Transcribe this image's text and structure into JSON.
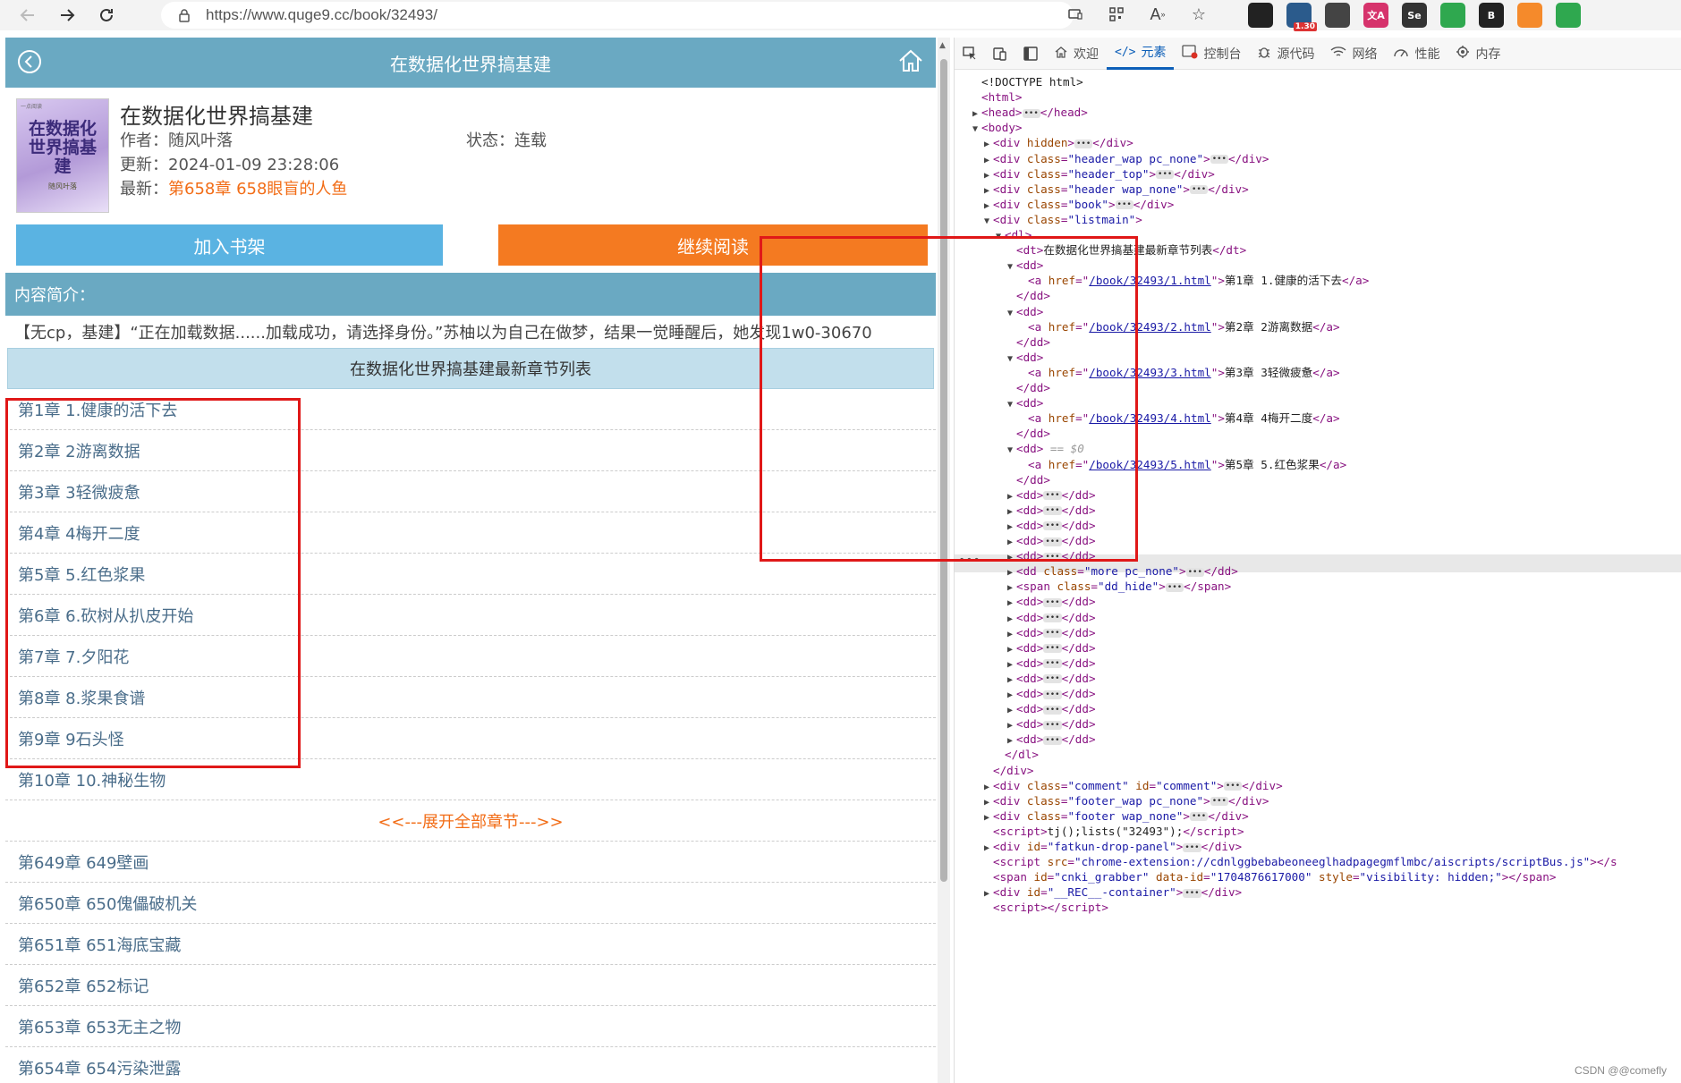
{
  "browser": {
    "url": "https://www.quge9.cc/book/32493/",
    "extensions": [
      {
        "name": "devtools-ext-icon",
        "color": "#222",
        "label": ""
      },
      {
        "name": "timer-ext-icon",
        "color": "#2b5b8c",
        "label": "",
        "badge": "1.30"
      },
      {
        "name": "gauge-ext-icon",
        "color": "#444",
        "label": ""
      },
      {
        "name": "translate-ext-icon",
        "color": "#d6336c",
        "label": "文A"
      },
      {
        "name": "selenium-ext-icon",
        "color": "#333",
        "label": "Se"
      },
      {
        "name": "shield-ext-icon",
        "color": "#2fa84f",
        "label": ""
      },
      {
        "name": "coin-ext-icon",
        "color": "#222",
        "label": "B"
      },
      {
        "name": "fire-ext-icon",
        "color": "#f58a2b",
        "label": ""
      },
      {
        "name": "download-ext-icon",
        "color": "#2fa84f",
        "label": ""
      }
    ]
  },
  "page": {
    "header_title": "在数据化世界搞基建",
    "book_title": "在数据化世界搞基建",
    "cover": {
      "title": "在数据化世界搞基建",
      "author": "随风叶落",
      "top_text": "一点阅读"
    },
    "author_label": "作者：",
    "author": "随风叶落",
    "status_label": "状态：",
    "status": "连载",
    "updated_label": "更新：",
    "updated": "2024-01-09 23:28:06",
    "latest_label": "最新：",
    "latest": "第658章 658眼盲的人鱼",
    "add_shelf": "加入书架",
    "continue_read": "继续阅读",
    "intro_heading": "内容简介：",
    "intro": "【无cp，基建】“正在加载数据......加载成功，请选择身份。”苏柚以为自己在做梦，结果一觉睡醒后，她发现1w0-30670",
    "list_heading": "在数据化世界搞基建最新章节列表",
    "chapters_top": [
      "第1章 1.健康的活下去",
      "第2章 2游离数据",
      "第3章 3轻微疲惫",
      "第4章 4梅开二度",
      "第5章 5.红色浆果",
      "第6章 6.砍树从扒皮开始",
      "第7章 7.夕阳花",
      "第8章 8.浆果食谱",
      "第9章 9石头怪",
      "第10章 10.神秘生物"
    ],
    "expand_all": "<<---展开全部章节--->>",
    "chapters_bottom": [
      "第649章 649壁画",
      "第650章 650傀儡破机关",
      "第651章 651海底宝藏",
      "第652章 652标记",
      "第653章 653无主之物",
      "第654章 654污染泄露"
    ]
  },
  "devtools": {
    "tabs": [
      {
        "name": "welcome",
        "label": "欢迎",
        "icon": "home-icon"
      },
      {
        "name": "elements",
        "label": "元素",
        "icon": "code-icon",
        "active": true
      },
      {
        "name": "console",
        "label": "控制台",
        "icon": "console-icon"
      },
      {
        "name": "sources",
        "label": "源代码",
        "icon": "bug-icon"
      },
      {
        "name": "network",
        "label": "网络",
        "icon": "wifi-icon"
      },
      {
        "name": "performance",
        "label": "性能",
        "icon": "performance-icon"
      },
      {
        "name": "memory",
        "label": "内存",
        "icon": "memory-icon"
      }
    ],
    "lines": [
      {
        "indent": 0,
        "tri": "",
        "html": "<span class='tx'>&lt;!DOCTYPE html&gt;</span>"
      },
      {
        "indent": 0,
        "tri": "",
        "html": "<span class='t'>&lt;html&gt;</span>"
      },
      {
        "indent": 0,
        "tri": "▶",
        "html": "<span class='t'>&lt;head&gt;</span><span class='ell'>•••</span><span class='t'>&lt;/head&gt;</span>"
      },
      {
        "indent": 0,
        "tri": "▼",
        "html": "<span class='t'>&lt;body&gt;</span>"
      },
      {
        "indent": 1,
        "tri": "▶",
        "html": "<span class='t'>&lt;div </span><span class='a'>hidden</span><span class='t'>&gt;</span><span class='ell'>•••</span><span class='t'>&lt;/div&gt;</span>"
      },
      {
        "indent": 1,
        "tri": "▶",
        "html": "<span class='t'>&lt;div </span><span class='a'>class</span><span class='t'>=</span><span class='s'>\"header_wap pc_none\"</span><span class='t'>&gt;</span><span class='ell'>•••</span><span class='t'>&lt;/div&gt;</span>"
      },
      {
        "indent": 1,
        "tri": "▶",
        "html": "<span class='t'>&lt;div </span><span class='a'>class</span><span class='t'>=</span><span class='s'>\"header_top\"</span><span class='t'>&gt;</span><span class='ell'>•••</span><span class='t'>&lt;/div&gt;</span>"
      },
      {
        "indent": 1,
        "tri": "▶",
        "html": "<span class='t'>&lt;div </span><span class='a'>class</span><span class='t'>=</span><span class='s'>\"header wap_none\"</span><span class='t'>&gt;</span><span class='ell'>•••</span><span class='t'>&lt;/div&gt;</span>"
      },
      {
        "indent": 1,
        "tri": "▶",
        "html": "<span class='t'>&lt;div </span><span class='a'>class</span><span class='t'>=</span><span class='s'>\"book\"</span><span class='t'>&gt;</span><span class='ell'>•••</span><span class='t'>&lt;/div&gt;</span>"
      },
      {
        "indent": 1,
        "tri": "▼",
        "html": "<span class='t'>&lt;div </span><span class='a'>class</span><span class='t'>=</span><span class='s'>\"listmain\"</span><span class='t'>&gt;</span>"
      },
      {
        "indent": 2,
        "tri": "▼",
        "html": "<span class='t'>&lt;dl&gt;</span>"
      },
      {
        "indent": 3,
        "tri": "",
        "html": "<span class='t'>&lt;dt&gt;</span><span class='tx'>在数据化世界搞基建最新章节列表</span><span class='t'>&lt;/dt&gt;</span>"
      },
      {
        "indent": 3,
        "tri": "▼",
        "html": "<span class='t'>&lt;dd&gt;</span>"
      },
      {
        "indent": 4,
        "tri": "",
        "html": "<span class='t'>&lt;a </span><span class='a'>href</span><span class='t'>=\"</span><span class='ak'>/book/32493/1.html</span><span class='t'>\"&gt;</span><span class='tx'>第1章 1.健康的活下去</span><span class='t'>&lt;/a&gt;</span>"
      },
      {
        "indent": 3,
        "tri": "",
        "html": "<span class='t'>&lt;/dd&gt;</span>"
      },
      {
        "indent": 3,
        "tri": "▼",
        "html": "<span class='t'>&lt;dd&gt;</span>"
      },
      {
        "indent": 4,
        "tri": "",
        "html": "<span class='t'>&lt;a </span><span class='a'>href</span><span class='t'>=\"</span><span class='ak'>/book/32493/2.html</span><span class='t'>\"&gt;</span><span class='tx'>第2章 2游离数据</span><span class='t'>&lt;/a&gt;</span>"
      },
      {
        "indent": 3,
        "tri": "",
        "html": "<span class='t'>&lt;/dd&gt;</span>"
      },
      {
        "indent": 3,
        "tri": "▼",
        "html": "<span class='t'>&lt;dd&gt;</span>"
      },
      {
        "indent": 4,
        "tri": "",
        "html": "<span class='t'>&lt;a </span><span class='a'>href</span><span class='t'>=\"</span><span class='ak'>/book/32493/3.html</span><span class='t'>\"&gt;</span><span class='tx'>第3章 3轻微疲惫</span><span class='t'>&lt;/a&gt;</span>"
      },
      {
        "indent": 3,
        "tri": "",
        "html": "<span class='t'>&lt;/dd&gt;</span>"
      },
      {
        "indent": 3,
        "tri": "▼",
        "html": "<span class='t'>&lt;dd&gt;</span>"
      },
      {
        "indent": 4,
        "tri": "",
        "html": "<span class='t'>&lt;a </span><span class='a'>href</span><span class='t'>=\"</span><span class='ak'>/book/32493/4.html</span><span class='t'>\"&gt;</span><span class='tx'>第4章 4梅开二度</span><span class='t'>&lt;/a&gt;</span>"
      },
      {
        "indent": 3,
        "tri": "",
        "html": "<span class='t'>&lt;/dd&gt;</span>"
      },
      {
        "indent": 3,
        "tri": "▼",
        "html": "<span class='t'>&lt;dd&gt;</span><span class='cm'> == $0</span>"
      },
      {
        "indent": 4,
        "tri": "",
        "html": "<span class='t'>&lt;a </span><span class='a'>href</span><span class='t'>=\"</span><span class='ak'>/book/32493/5.html</span><span class='t'>\"&gt;</span><span class='tx'>第5章 5.红色浆果</span><span class='t'>&lt;/a&gt;</span>"
      },
      {
        "indent": 3,
        "tri": "",
        "html": "<span class='t'>&lt;/dd&gt;</span>"
      },
      {
        "indent": 3,
        "tri": "▶",
        "html": "<span class='t'>&lt;dd&gt;</span><span class='ell'>•••</span><span class='t'>&lt;/dd&gt;</span>"
      },
      {
        "indent": 3,
        "tri": "▶",
        "html": "<span class='t'>&lt;dd&gt;</span><span class='ell'>•••</span><span class='t'>&lt;/dd&gt;</span>"
      },
      {
        "indent": 3,
        "tri": "▶",
        "html": "<span class='t'>&lt;dd&gt;</span><span class='ell'>•••</span><span class='t'>&lt;/dd&gt;</span>"
      },
      {
        "indent": 3,
        "tri": "▶",
        "html": "<span class='t'>&lt;dd&gt;</span><span class='ell'>•••</span><span class='t'>&lt;/dd&gt;</span>"
      },
      {
        "indent": 3,
        "tri": "▶",
        "html": "<span class='t'>&lt;dd&gt;</span><span class='ell'>•••</span><span class='t'>&lt;/dd&gt;</span>"
      },
      {
        "indent": 3,
        "tri": "▶",
        "html": "<span class='t'>&lt;dd </span><span class='a'>class</span><span class='t'>=</span><span class='s'>\"more pc_none\"</span><span class='t'>&gt;</span><span class='ell'>•••</span><span class='t'>&lt;/dd&gt;</span>"
      },
      {
        "indent": 3,
        "tri": "▶",
        "html": "<span class='t'>&lt;span </span><span class='a'>class</span><span class='t'>=</span><span class='s'>\"dd_hide\"</span><span class='t'>&gt;</span><span class='ell'>•••</span><span class='t'>&lt;/span&gt;</span>"
      },
      {
        "indent": 3,
        "tri": "▶",
        "html": "<span class='t'>&lt;dd&gt;</span><span class='ell'>•••</span><span class='t'>&lt;/dd&gt;</span>"
      },
      {
        "indent": 3,
        "tri": "▶",
        "html": "<span class='t'>&lt;dd&gt;</span><span class='ell'>•••</span><span class='t'>&lt;/dd&gt;</span>"
      },
      {
        "indent": 3,
        "tri": "▶",
        "html": "<span class='t'>&lt;dd&gt;</span><span class='ell'>•••</span><span class='t'>&lt;/dd&gt;</span>"
      },
      {
        "indent": 3,
        "tri": "▶",
        "html": "<span class='t'>&lt;dd&gt;</span><span class='ell'>•••</span><span class='t'>&lt;/dd&gt;</span>"
      },
      {
        "indent": 3,
        "tri": "▶",
        "html": "<span class='t'>&lt;dd&gt;</span><span class='ell'>•••</span><span class='t'>&lt;/dd&gt;</span>"
      },
      {
        "indent": 3,
        "tri": "▶",
        "html": "<span class='t'>&lt;dd&gt;</span><span class='ell'>•••</span><span class='t'>&lt;/dd&gt;</span>"
      },
      {
        "indent": 3,
        "tri": "▶",
        "html": "<span class='t'>&lt;dd&gt;</span><span class='ell'>•••</span><span class='t'>&lt;/dd&gt;</span>"
      },
      {
        "indent": 3,
        "tri": "▶",
        "html": "<span class='t'>&lt;dd&gt;</span><span class='ell'>•••</span><span class='t'>&lt;/dd&gt;</span>"
      },
      {
        "indent": 3,
        "tri": "▶",
        "html": "<span class='t'>&lt;dd&gt;</span><span class='ell'>•••</span><span class='t'>&lt;/dd&gt;</span>"
      },
      {
        "indent": 3,
        "tri": "▶",
        "html": "<span class='t'>&lt;dd&gt;</span><span class='ell'>•••</span><span class='t'>&lt;/dd&gt;</span>"
      },
      {
        "indent": 2,
        "tri": "",
        "html": "<span class='t'>&lt;/dl&gt;</span>"
      },
      {
        "indent": 1,
        "tri": "",
        "html": "<span class='t'>&lt;/div&gt;</span>"
      },
      {
        "indent": 1,
        "tri": "▶",
        "html": "<span class='t'>&lt;div </span><span class='a'>class</span><span class='t'>=</span><span class='s'>\"comment\"</span><span class='t'> </span><span class='a'>id</span><span class='t'>=</span><span class='s'>\"comment\"</span><span class='t'>&gt;</span><span class='ell'>•••</span><span class='t'>&lt;/div&gt;</span>"
      },
      {
        "indent": 1,
        "tri": "▶",
        "html": "<span class='t'>&lt;div </span><span class='a'>class</span><span class='t'>=</span><span class='s'>\"footer_wap pc_none\"</span><span class='t'>&gt;</span><span class='ell'>•••</span><span class='t'>&lt;/div&gt;</span>"
      },
      {
        "indent": 1,
        "tri": "▶",
        "html": "<span class='t'>&lt;div </span><span class='a'>class</span><span class='t'>=</span><span class='s'>\"footer wap_none\"</span><span class='t'>&gt;</span><span class='ell'>•••</span><span class='t'>&lt;/div&gt;</span>"
      },
      {
        "indent": 1,
        "tri": "",
        "html": "<span class='t'>&lt;script&gt;</span><span class='tx'>tj();lists(\"32493\");</span><span class='t'>&lt;/script&gt;</span>"
      },
      {
        "indent": 1,
        "tri": "▶",
        "html": "<span class='t'>&lt;div </span><span class='a'>id</span><span class='t'>=</span><span class='s'>\"fatkun-drop-panel\"</span><span class='t'>&gt;</span><span class='ell'>•••</span><span class='t'>&lt;/div&gt;</span>"
      },
      {
        "indent": 1,
        "tri": "",
        "html": "<span class='t'>&lt;script </span><span class='a'>src</span><span class='t'>=</span><span class='s'>\"chrome-extension://cdnlggbebabeoneeglhadpagegmflmbc/aiscripts/scriptBus.js\"</span><span class='t'>&gt;&lt;/s</span>"
      },
      {
        "indent": 1,
        "tri": "",
        "html": "<span class='t'>&lt;span </span><span class='a'>id</span><span class='t'>=</span><span class='s'>\"cnki_grabber\"</span><span class='t'> </span><span class='a'>data-id</span><span class='t'>=</span><span class='s'>\"1704876617000\"</span><span class='t'> </span><span class='a'>style</span><span class='t'>=</span><span class='s'>\"visibility: hidden;\"</span><span class='t'>&gt;&lt;/span&gt;</span>"
      },
      {
        "indent": 1,
        "tri": "▶",
        "html": "<span class='t'>&lt;div </span><span class='a'>id</span><span class='t'>=</span><span class='s'>\"__REC__-container\"</span><span class='t'>&gt;</span><span class='ell'>•••</span><span class='t'>&lt;/div&gt;</span>"
      },
      {
        "indent": 1,
        "tri": "",
        "html": "<span class='t'>&lt;script&gt;&lt;/script&gt;</span>"
      }
    ]
  },
  "watermark": "CSDN @@comefly"
}
